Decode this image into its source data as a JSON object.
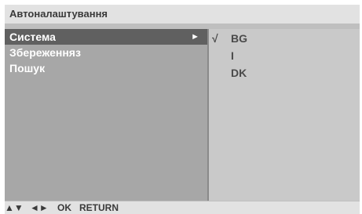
{
  "title": "Автоналаштування",
  "left_menu": [
    {
      "label": "Система",
      "arrow": "►",
      "selected": true
    },
    {
      "label": "Збереженняз",
      "selected": false
    },
    {
      "label": "Пошук",
      "selected": false
    }
  ],
  "right_options": [
    {
      "label": "BG",
      "checked": true,
      "check_mark": "√"
    },
    {
      "label": "I",
      "checked": false
    },
    {
      "label": "DK",
      "checked": false
    }
  ],
  "footer": {
    "nav_up_down": "▲▼",
    "nav_left_right": "◄►",
    "ok_label": "OK",
    "return_label": "RETURN"
  },
  "colors": {
    "title_bg": "#e2e2e2",
    "left_pane_bg": "#a7a7a7",
    "selected_bg": "#606060",
    "right_pane_bg": "#c9c9c9"
  }
}
